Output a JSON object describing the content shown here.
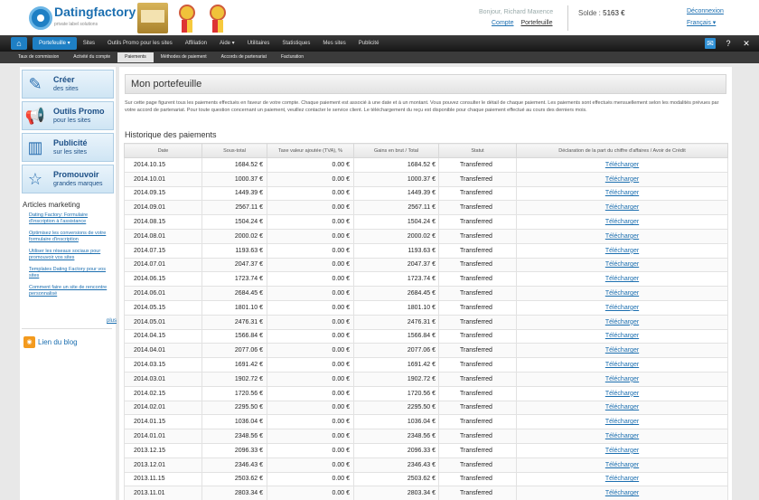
{
  "header": {
    "logo_text": "Datingfactory",
    "logo_tagline": "private label solutions",
    "user_line": "Bonjour, Richard Maxence",
    "account_link": "Compte",
    "portfolio_link": "Portefeuille",
    "balance_label": "Solde :",
    "balance_value": "5163 €",
    "logout": "Déconnexion",
    "language": "Français ▾"
  },
  "nav": {
    "items": [
      "Portefeuille ▾",
      "Sites",
      "Outils Promo pour les sites",
      "Affiliation",
      "Aide ▾",
      "Utilitaires",
      "Statistiques",
      "Mes sites",
      "Publicité"
    ],
    "icons": [
      "mail-icon",
      "help-icon",
      "close-icon"
    ]
  },
  "subnav": {
    "items": [
      "Taux de commission",
      "Activité du compte",
      "Paiements",
      "Méthodes de paiement",
      "Accords de partenariat",
      "Facturation"
    ]
  },
  "sidebar": {
    "promos": [
      {
        "title": "Créer",
        "subtitle": "des sites"
      },
      {
        "title": "Outils Promo",
        "subtitle": "pour les sites"
      },
      {
        "title": "Publicité",
        "subtitle": "sur les sites"
      },
      {
        "title": "Promouvoir",
        "subtitle": "grandes marques"
      }
    ],
    "articles_heading": "Articles marketing",
    "articles": [
      "Dating Factory: Formulaire d'inscription à l'assistance",
      "Optimisez les conversions de votre formulaire d'inscription",
      "Utiliser les réseaux sociaux pour promouvoir vos sites",
      "Templates Dating Factory pour vos sites",
      "Comment faire un site de rencontre personnalisé"
    ],
    "more": "plus",
    "blog": "Lien du blog"
  },
  "main": {
    "title": "Mon portefeuille",
    "intro": "Sur cette page figurent tous les paiements effectués en faveur de votre compte. Chaque paiement est associé à une date et à un montant. Vous pouvez consulter le détail de chaque paiement. Les paiements sont effectués mensuellement selon les modalités prévues par votre accord de partenariat. Pour toute question concernant un paiement, veuillez contacter le service client. Le téléchargement du reçu est disponible pour chaque paiement effectué au cours des derniers mois.",
    "history_title": "Historique des paiements",
    "columns": [
      "Date",
      "Sous-total",
      "Taxe valeur ajoutée (TVA), %",
      "Gains en brut / Total",
      "Statut",
      "Déclaration de la part du chiffre d'affaires / Avoir de Crédit"
    ],
    "rows": [
      {
        "date": "2014.10.15",
        "subtotal": "1684.52 €",
        "tax": "0.00 €",
        "gross": "1684.52 €",
        "status": "Transferred",
        "link": "Télécharger"
      },
      {
        "date": "2014.10.01",
        "subtotal": "1000.37 €",
        "tax": "0.00 €",
        "gross": "1000.37 €",
        "status": "Transferred",
        "link": "Télécharger"
      },
      {
        "date": "2014.09.15",
        "subtotal": "1449.39 €",
        "tax": "0.00 €",
        "gross": "1449.39 €",
        "status": "Transferred",
        "link": "Télécharger"
      },
      {
        "date": "2014.09.01",
        "subtotal": "2567.11 €",
        "tax": "0.00 €",
        "gross": "2567.11 €",
        "status": "Transferred",
        "link": "Télécharger"
      },
      {
        "date": "2014.08.15",
        "subtotal": "1504.24 €",
        "tax": "0.00 €",
        "gross": "1504.24 €",
        "status": "Transferred",
        "link": "Télécharger"
      },
      {
        "date": "2014.08.01",
        "subtotal": "2000.02 €",
        "tax": "0.00 €",
        "gross": "2000.02 €",
        "status": "Transferred",
        "link": "Télécharger"
      },
      {
        "date": "2014.07.15",
        "subtotal": "1193.63 €",
        "tax": "0.00 €",
        "gross": "1193.63 €",
        "status": "Transferred",
        "link": "Télécharger"
      },
      {
        "date": "2014.07.01",
        "subtotal": "2047.37 €",
        "tax": "0.00 €",
        "gross": "2047.37 €",
        "status": "Transferred",
        "link": "Télécharger"
      },
      {
        "date": "2014.06.15",
        "subtotal": "1723.74 €",
        "tax": "0.00 €",
        "gross": "1723.74 €",
        "status": "Transferred",
        "link": "Télécharger"
      },
      {
        "date": "2014.06.01",
        "subtotal": "2684.45 €",
        "tax": "0.00 €",
        "gross": "2684.45 €",
        "status": "Transferred",
        "link": "Télécharger"
      },
      {
        "date": "2014.05.15",
        "subtotal": "1801.10 €",
        "tax": "0.00 €",
        "gross": "1801.10 €",
        "status": "Transferred",
        "link": "Télécharger"
      },
      {
        "date": "2014.05.01",
        "subtotal": "2476.31 €",
        "tax": "0.00 €",
        "gross": "2476.31 €",
        "status": "Transferred",
        "link": "Télécharger"
      },
      {
        "date": "2014.04.15",
        "subtotal": "1566.84 €",
        "tax": "0.00 €",
        "gross": "1566.84 €",
        "status": "Transferred",
        "link": "Télécharger"
      },
      {
        "date": "2014.04.01",
        "subtotal": "2077.06 €",
        "tax": "0.00 €",
        "gross": "2077.06 €",
        "status": "Transferred",
        "link": "Télécharger"
      },
      {
        "date": "2014.03.15",
        "subtotal": "1691.42 €",
        "tax": "0.00 €",
        "gross": "1691.42 €",
        "status": "Transferred",
        "link": "Télécharger"
      },
      {
        "date": "2014.03.01",
        "subtotal": "1902.72 €",
        "tax": "0.00 €",
        "gross": "1902.72 €",
        "status": "Transferred",
        "link": "Télécharger"
      },
      {
        "date": "2014.02.15",
        "subtotal": "1720.56 €",
        "tax": "0.00 €",
        "gross": "1720.56 €",
        "status": "Transferred",
        "link": "Télécharger"
      },
      {
        "date": "2014.02.01",
        "subtotal": "2295.50 €",
        "tax": "0.00 €",
        "gross": "2295.50 €",
        "status": "Transferred",
        "link": "Télécharger"
      },
      {
        "date": "2014.01.15",
        "subtotal": "1036.04 €",
        "tax": "0.00 €",
        "gross": "1036.04 €",
        "status": "Transferred",
        "link": "Télécharger"
      },
      {
        "date": "2014.01.01",
        "subtotal": "2348.56 €",
        "tax": "0.00 €",
        "gross": "2348.56 €",
        "status": "Transferred",
        "link": "Télécharger"
      },
      {
        "date": "2013.12.15",
        "subtotal": "2096.33 €",
        "tax": "0.00 €",
        "gross": "2096.33 €",
        "status": "Transferred",
        "link": "Télécharger"
      },
      {
        "date": "2013.12.01",
        "subtotal": "2346.43 €",
        "tax": "0.00 €",
        "gross": "2346.43 €",
        "status": "Transferred",
        "link": "Télécharger"
      },
      {
        "date": "2013.11.15",
        "subtotal": "2503.62 €",
        "tax": "0.00 €",
        "gross": "2503.62 €",
        "status": "Transferred",
        "link": "Télécharger"
      },
      {
        "date": "2013.11.01",
        "subtotal": "2803.34 €",
        "tax": "0.00 €",
        "gross": "2803.34 €",
        "status": "Transferred",
        "link": "Télécharger"
      }
    ]
  }
}
